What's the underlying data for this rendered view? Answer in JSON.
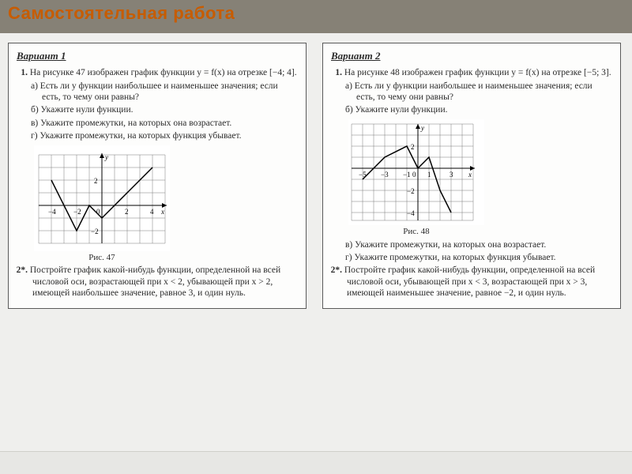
{
  "header": {
    "title": "Самостоятельная работа"
  },
  "variant1": {
    "label": "Вариант 1",
    "q1": "На рисунке 47 изображен график функции y = f(x) на отрезке [−4; 4].",
    "q1a": "а) Есть ли у функции наибольшее и наименьшее значения; если есть, то чему они равны?",
    "q1b": "б) Укажите нули функции.",
    "q1c": "в) Укажите промежутки, на которых она возрастает.",
    "q1d": "г) Укажите промежутки, на которых функция убывает.",
    "fig_caption": "Рис. 47",
    "q2": "Постройте график какой-нибудь функции, определенной на всей числовой оси, возрастающей при x < 2, убывающей при x > 2, имеющей наибольшее значение, равное 3, и один нуль.",
    "num1": "1.",
    "num2": "2*."
  },
  "variant2": {
    "label": "Вариант 2",
    "q1": "На рисунке 48 изображен график функции y = f(x) на отрезке [−5; 3].",
    "q1a": "а) Есть ли у функции наибольшее и наименьшее значения; если есть, то чему они равны?",
    "q1b": "б) Укажите нули функции.",
    "fig_caption": "Рис. 48",
    "q1c": "в) Укажите промежутки, на которых она возрастает.",
    "q1d": "г) Укажите промежутки, на которых функция убывает.",
    "q2": "Постройте график какой-нибудь функции, определенной на всей числовой оси, убывающей при x < 3, возрастающей при x > 3, имеющей наименьшее значение, равное −2, и один нуль.",
    "num1": "1.",
    "num2": "2*."
  },
  "axes": {
    "x_label": "x",
    "y_label": "y",
    "origin": "0"
  },
  "chart_data": [
    {
      "type": "line",
      "title": "Рис. 47",
      "xlabel": "x",
      "ylabel": "y",
      "xlim": [
        -5,
        5
      ],
      "ylim": [
        -3,
        4
      ],
      "x": [
        -4,
        -2,
        -1,
        0,
        1,
        2,
        4
      ],
      "y": [
        2,
        -2,
        0,
        -1,
        0,
        1,
        3
      ],
      "x_ticks": [
        -4,
        -2,
        2,
        4
      ],
      "y_ticks": [
        -2,
        2
      ]
    },
    {
      "type": "line",
      "title": "Рис. 48",
      "xlabel": "x",
      "ylabel": "y",
      "xlim": [
        -6,
        5
      ],
      "ylim": [
        -5,
        4
      ],
      "x": [
        -5,
        -3,
        -1,
        0,
        1,
        2,
        3
      ],
      "y": [
        -1,
        1,
        2,
        0,
        1,
        -2,
        -4
      ],
      "x_ticks": [
        -5,
        -3,
        -1,
        1,
        3
      ],
      "y_ticks": [
        -4,
        -2,
        2
      ]
    }
  ]
}
